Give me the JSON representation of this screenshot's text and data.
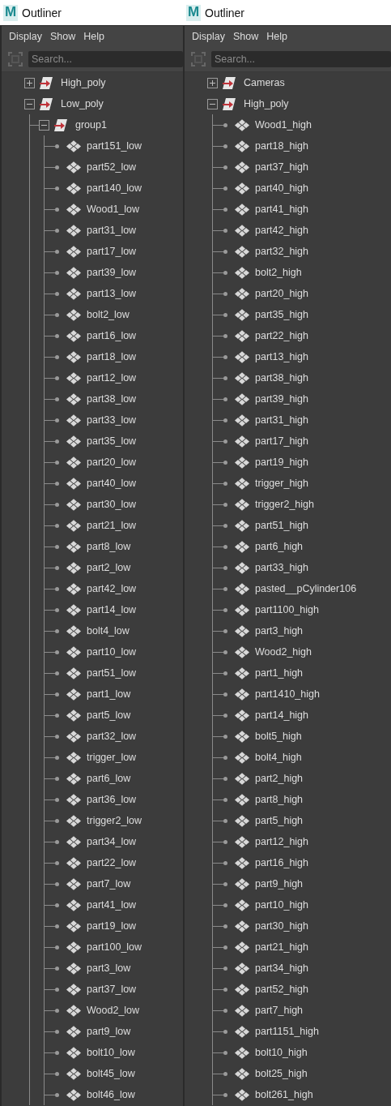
{
  "panels": [
    {
      "logo": "M",
      "title": "Outliner",
      "menu": [
        "Display",
        "Show",
        "Help"
      ],
      "search": {
        "placeholder": "Search..."
      },
      "tree": [
        {
          "label": "High_poly",
          "kind": "group",
          "expanded": false
        },
        {
          "label": "Low_poly",
          "kind": "group",
          "expanded": true,
          "children": [
            {
              "label": "group1",
              "kind": "group",
              "expanded": true,
              "children": [
                {
                  "label": "part151_low",
                  "kind": "mesh"
                },
                {
                  "label": "part52_low",
                  "kind": "mesh"
                },
                {
                  "label": "part140_low",
                  "kind": "mesh"
                },
                {
                  "label": "Wood1_low",
                  "kind": "mesh"
                },
                {
                  "label": "part31_low",
                  "kind": "mesh"
                },
                {
                  "label": "part17_low",
                  "kind": "mesh"
                },
                {
                  "label": "part39_low",
                  "kind": "mesh"
                },
                {
                  "label": "part13_low",
                  "kind": "mesh"
                },
                {
                  "label": "bolt2_low",
                  "kind": "mesh"
                },
                {
                  "label": "part16_low",
                  "kind": "mesh"
                },
                {
                  "label": "part18_low",
                  "kind": "mesh"
                },
                {
                  "label": "part12_low",
                  "kind": "mesh"
                },
                {
                  "label": "part38_low",
                  "kind": "mesh"
                },
                {
                  "label": "part33_low",
                  "kind": "mesh"
                },
                {
                  "label": "part35_low",
                  "kind": "mesh"
                },
                {
                  "label": "part20_low",
                  "kind": "mesh"
                },
                {
                  "label": "part40_low",
                  "kind": "mesh"
                },
                {
                  "label": "part30_low",
                  "kind": "mesh"
                },
                {
                  "label": "part21_low",
                  "kind": "mesh"
                },
                {
                  "label": "part8_low",
                  "kind": "mesh"
                },
                {
                  "label": "part2_low",
                  "kind": "mesh"
                },
                {
                  "label": "part42_low",
                  "kind": "mesh"
                },
                {
                  "label": "part14_low",
                  "kind": "mesh"
                },
                {
                  "label": "bolt4_low",
                  "kind": "mesh"
                },
                {
                  "label": "part10_low",
                  "kind": "mesh"
                },
                {
                  "label": "part51_low",
                  "kind": "mesh"
                },
                {
                  "label": "part1_low",
                  "kind": "mesh"
                },
                {
                  "label": "part5_low",
                  "kind": "mesh"
                },
                {
                  "label": "part32_low",
                  "kind": "mesh"
                },
                {
                  "label": "trigger_low",
                  "kind": "mesh"
                },
                {
                  "label": "part6_low",
                  "kind": "mesh"
                },
                {
                  "label": "part36_low",
                  "kind": "mesh"
                },
                {
                  "label": "trigger2_low",
                  "kind": "mesh"
                },
                {
                  "label": "part34_low",
                  "kind": "mesh"
                },
                {
                  "label": "part22_low",
                  "kind": "mesh"
                },
                {
                  "label": "part7_low",
                  "kind": "mesh"
                },
                {
                  "label": "part41_low",
                  "kind": "mesh"
                },
                {
                  "label": "part19_low",
                  "kind": "mesh"
                },
                {
                  "label": "part100_low",
                  "kind": "mesh"
                },
                {
                  "label": "part3_low",
                  "kind": "mesh"
                },
                {
                  "label": "part37_low",
                  "kind": "mesh"
                },
                {
                  "label": "Wood2_low",
                  "kind": "mesh"
                },
                {
                  "label": "part9_low",
                  "kind": "mesh"
                },
                {
                  "label": "bolt10_low",
                  "kind": "mesh"
                },
                {
                  "label": "bolt45_low",
                  "kind": "mesh"
                },
                {
                  "label": "bolt46_low",
                  "kind": "mesh"
                }
              ]
            }
          ]
        }
      ]
    },
    {
      "logo": "M",
      "title": "Outliner",
      "menu": [
        "Display",
        "Show",
        "Help"
      ],
      "search": {
        "placeholder": "Search..."
      },
      "tree": [
        {
          "label": "Cameras",
          "kind": "group",
          "expanded": false
        },
        {
          "label": "High_poly",
          "kind": "group",
          "expanded": true,
          "children": [
            {
              "label": "Wood1_high",
              "kind": "mesh"
            },
            {
              "label": "part18_high",
              "kind": "mesh"
            },
            {
              "label": "part37_high",
              "kind": "mesh"
            },
            {
              "label": "part40_high",
              "kind": "mesh"
            },
            {
              "label": "part41_high",
              "kind": "mesh"
            },
            {
              "label": "part42_high",
              "kind": "mesh"
            },
            {
              "label": "part32_high",
              "kind": "mesh"
            },
            {
              "label": "bolt2_high",
              "kind": "mesh"
            },
            {
              "label": "part20_high",
              "kind": "mesh"
            },
            {
              "label": "part35_high",
              "kind": "mesh"
            },
            {
              "label": "part22_high",
              "kind": "mesh"
            },
            {
              "label": "part13_high",
              "kind": "mesh"
            },
            {
              "label": "part38_high",
              "kind": "mesh"
            },
            {
              "label": "part39_high",
              "kind": "mesh"
            },
            {
              "label": "part31_high",
              "kind": "mesh"
            },
            {
              "label": "part17_high",
              "kind": "mesh"
            },
            {
              "label": "part19_high",
              "kind": "mesh"
            },
            {
              "label": "trigger_high",
              "kind": "mesh"
            },
            {
              "label": "trigger2_high",
              "kind": "mesh"
            },
            {
              "label": "part51_high",
              "kind": "mesh"
            },
            {
              "label": "part6_high",
              "kind": "mesh"
            },
            {
              "label": "part33_high",
              "kind": "mesh"
            },
            {
              "label": "pasted__pCylinder106",
              "kind": "mesh"
            },
            {
              "label": "part1100_high",
              "kind": "mesh"
            },
            {
              "label": "part3_high",
              "kind": "mesh"
            },
            {
              "label": "Wood2_high",
              "kind": "mesh"
            },
            {
              "label": "part1_high",
              "kind": "mesh"
            },
            {
              "label": "part1410_high",
              "kind": "mesh"
            },
            {
              "label": "part14_high",
              "kind": "mesh"
            },
            {
              "label": "bolt5_high",
              "kind": "mesh"
            },
            {
              "label": "bolt4_high",
              "kind": "mesh"
            },
            {
              "label": "part2_high",
              "kind": "mesh"
            },
            {
              "label": "part8_high",
              "kind": "mesh"
            },
            {
              "label": "part5_high",
              "kind": "mesh"
            },
            {
              "label": "part12_high",
              "kind": "mesh"
            },
            {
              "label": "part16_high",
              "kind": "mesh"
            },
            {
              "label": "part9_high",
              "kind": "mesh"
            },
            {
              "label": "part10_high",
              "kind": "mesh"
            },
            {
              "label": "part30_high",
              "kind": "mesh"
            },
            {
              "label": "part21_high",
              "kind": "mesh"
            },
            {
              "label": "part34_high",
              "kind": "mesh"
            },
            {
              "label": "part52_high",
              "kind": "mesh"
            },
            {
              "label": "part7_high",
              "kind": "mesh"
            },
            {
              "label": "part1151_high",
              "kind": "mesh"
            },
            {
              "label": "bolt10_high",
              "kind": "mesh"
            },
            {
              "label": "bolt25_high",
              "kind": "mesh"
            },
            {
              "label": "bolt261_high",
              "kind": "mesh"
            }
          ]
        }
      ]
    }
  ]
}
